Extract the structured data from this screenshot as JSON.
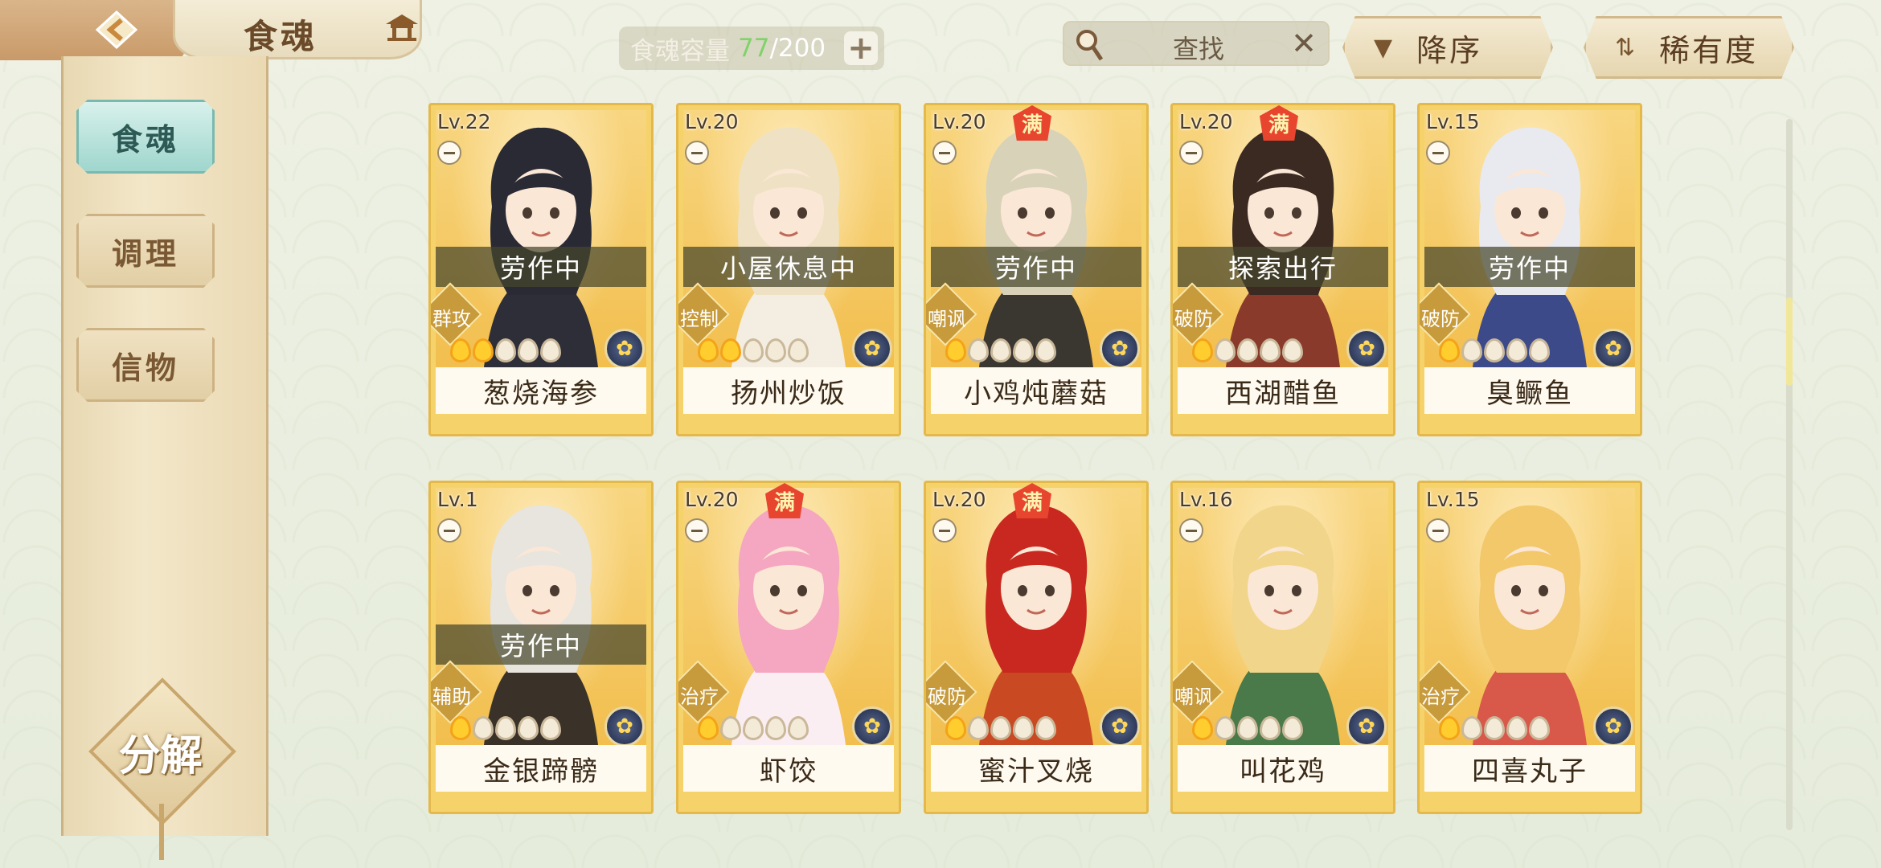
{
  "header": {
    "title": "食魂",
    "capacity_label": "食魂容量",
    "capacity_current": "77",
    "capacity_max": "/200",
    "capacity_add": "+",
    "search_placeholder": "查找",
    "search_clear": "✕",
    "sort_order_label": "降序",
    "sort_field_label": "稀有度"
  },
  "sidebar": {
    "items": [
      {
        "label": "食魂",
        "active": true
      },
      {
        "label": "调理",
        "active": false
      },
      {
        "label": "信物",
        "active": false
      }
    ],
    "decompose_label": "分解"
  },
  "colors": {
    "active_tab": "#9fd6cd",
    "card_gold": "#f6d36a",
    "max_badge": "#e8452f",
    "capacity_value": "#7fd36a"
  },
  "max_badge_text": "满",
  "cards": [
    {
      "level": "Lv.22",
      "name": "葱烧海参",
      "status": "劳作中",
      "role": "群攻",
      "stars": 2,
      "max": false,
      "hair": "#2a2a35",
      "coat": "#2e2e38"
    },
    {
      "level": "Lv.20",
      "name": "扬州炒饭",
      "status": "小屋休息中",
      "role": "控制",
      "stars": 2,
      "max": false,
      "hair": "#efe2c4",
      "coat": "#f4eee2"
    },
    {
      "level": "Lv.20",
      "name": "小鸡炖蘑菇",
      "status": "劳作中",
      "role": "嘲讽",
      "stars": 1,
      "max": true,
      "hair": "#d8d2b8",
      "coat": "#3a3630"
    },
    {
      "level": "Lv.20",
      "name": "西湖醋鱼",
      "status": "探索出行",
      "role": "破防",
      "stars": 1,
      "max": true,
      "hair": "#3a2a22",
      "coat": "#8a3a2a"
    },
    {
      "level": "Lv.15",
      "name": "臭鳜鱼",
      "status": "劳作中",
      "role": "破防",
      "stars": 1,
      "max": false,
      "hair": "#e9e9f0",
      "coat": "#3d4a8a"
    },
    {
      "level": "Lv.1",
      "name": "金银蹄髈",
      "status": "劳作中",
      "role": "辅助",
      "stars": 1,
      "max": false,
      "hair": "#e8e4de",
      "coat": "#3a3228"
    },
    {
      "level": "Lv.20",
      "name": "虾饺",
      "status": "",
      "role": "治疗",
      "stars": 1,
      "max": true,
      "hair": "#f5a6c0",
      "coat": "#fbeef2"
    },
    {
      "level": "Lv.20",
      "name": "蜜汁叉烧",
      "status": "",
      "role": "破防",
      "stars": 1,
      "max": true,
      "hair": "#c8281f",
      "coat": "#c94a22"
    },
    {
      "level": "Lv.16",
      "name": "叫花鸡",
      "status": "",
      "role": "嘲讽",
      "stars": 1,
      "max": false,
      "hair": "#f1d58a",
      "coat": "#4a7a4a"
    },
    {
      "level": "Lv.15",
      "name": "四喜丸子",
      "status": "",
      "role": "治疗",
      "stars": 1,
      "max": false,
      "hair": "#f2c86a",
      "coat": "#d8584a"
    }
  ]
}
